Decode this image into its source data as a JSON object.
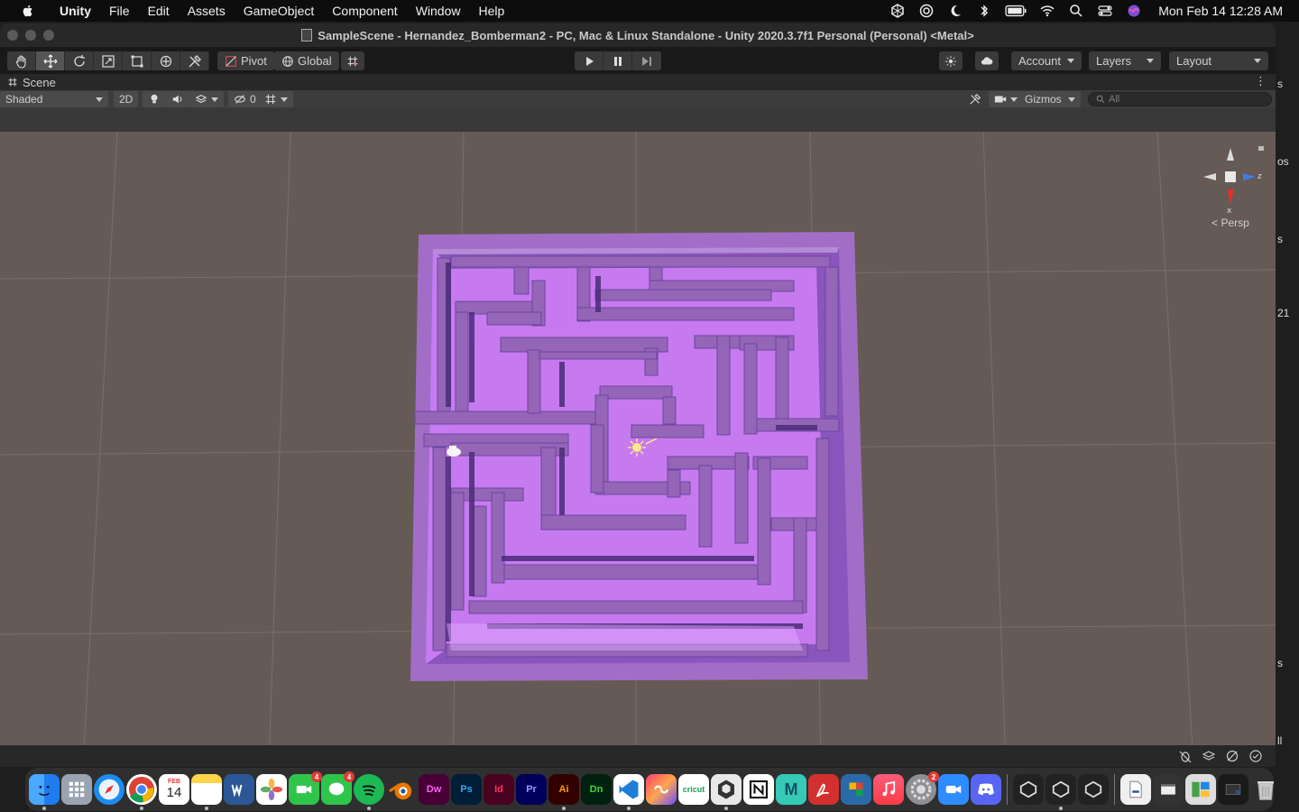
{
  "menubar": {
    "app_name": "Unity",
    "items": [
      "File",
      "Edit",
      "Assets",
      "GameObject",
      "Component",
      "Window",
      "Help"
    ],
    "clock": "Mon Feb 14  12:28 AM"
  },
  "window": {
    "title": "SampleScene - Hernandez_Bomberman2 - PC, Mac & Linux Standalone - Unity 2020.3.7f1 Personal (Personal) <Metal>"
  },
  "toolbar": {
    "pivot_label": "Pivot",
    "global_label": "Global",
    "account_label": "Account",
    "layers_label": "Layers",
    "layout_label": "Layout"
  },
  "scene": {
    "tab_label": "Scene",
    "shading_mode": "Shaded",
    "mode_2d": "2D",
    "hidden_count": "0",
    "gizmos_label": "Gizmos",
    "search_placeholder": "All",
    "view_label": "Persp",
    "axis_x": "x",
    "axis_z": "z"
  },
  "right_panel": {
    "fragments": [
      "s",
      "os",
      "s",
      "21",
      "s",
      "ll"
    ]
  },
  "dock": {
    "calendar_month": "FEB",
    "calendar_day": "14",
    "badge_facetime": "4",
    "badge_messages": "4",
    "badge_settings": "2",
    "labels": {
      "dw": "Dw",
      "ps": "Ps",
      "id": "Id",
      "pr": "Pr",
      "ai": "Ai",
      "dn": "Dn",
      "cricut": "cricut",
      "maya": "M"
    }
  },
  "colors": {
    "scene_bg": "#655a55",
    "maze_floor": "#c77af0",
    "maze_wall": "#9565b8",
    "maze_shadow": "#4a2c78",
    "accent": "#3d7ee6"
  }
}
